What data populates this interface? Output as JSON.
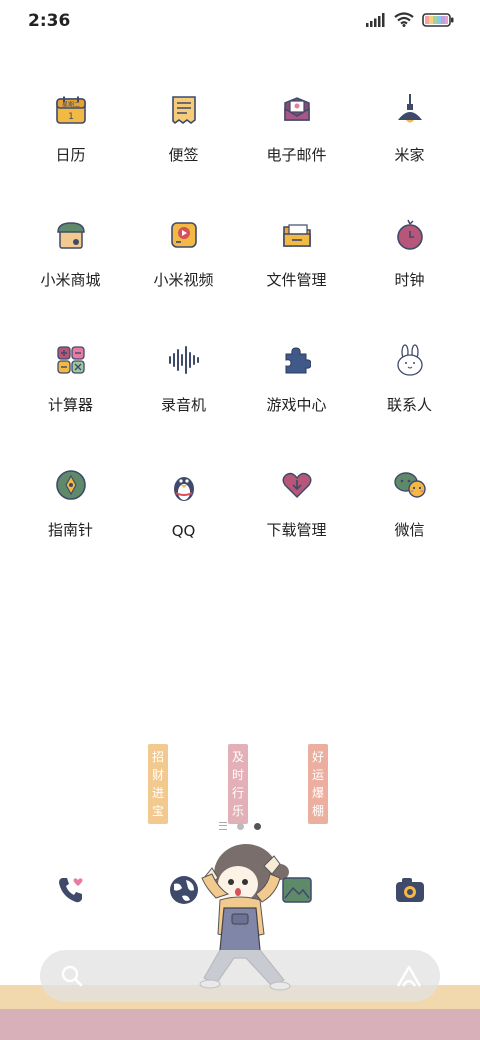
{
  "status_bar": {
    "time": "2:36"
  },
  "apps": [
    {
      "label": "日历",
      "icon": "calendar-icon",
      "badge_text": "星期二",
      "day": "1"
    },
    {
      "label": "便签",
      "icon": "notes-icon"
    },
    {
      "label": "电子邮件",
      "icon": "email-icon"
    },
    {
      "label": "米家",
      "icon": "lamp-icon"
    },
    {
      "label": "小米商城",
      "icon": "store-icon"
    },
    {
      "label": "小米视频",
      "icon": "video-icon"
    },
    {
      "label": "文件管理",
      "icon": "folder-icon"
    },
    {
      "label": "时钟",
      "icon": "clock-icon"
    },
    {
      "label": "计算器",
      "icon": "calculator-icon"
    },
    {
      "label": "录音机",
      "icon": "recorder-icon"
    },
    {
      "label": "游戏中心",
      "icon": "puzzle-icon"
    },
    {
      "label": "联系人",
      "icon": "bunny-icon"
    },
    {
      "label": "指南针",
      "icon": "compass-icon"
    },
    {
      "label": "QQ",
      "icon": "penguin-icon"
    },
    {
      "label": "下载管理",
      "icon": "download-heart-icon"
    },
    {
      "label": "微信",
      "icon": "chat-icon"
    }
  ],
  "wallpaper": {
    "banners": [
      {
        "chars": [
          "招",
          "财",
          "进",
          "宝"
        ],
        "color": "#f2c98e"
      },
      {
        "chars": [
          "及",
          "时",
          "行",
          "乐"
        ],
        "color": "#e3b0b8"
      },
      {
        "chars": [
          "好",
          "运",
          "爆",
          "棚"
        ],
        "color": "#ecae9e"
      }
    ]
  },
  "page_indicator": {
    "pages": 2,
    "active": 2
  },
  "dock": [
    {
      "icon": "phone-icon"
    },
    {
      "icon": "browser-globe-icon"
    },
    {
      "icon": "gallery-icon"
    },
    {
      "icon": "camera-icon"
    }
  ],
  "colors": {
    "navy": "#3f4a6b",
    "yellow": "#f2b944",
    "pink": "#c74f78",
    "green": "#5f8a6a"
  }
}
